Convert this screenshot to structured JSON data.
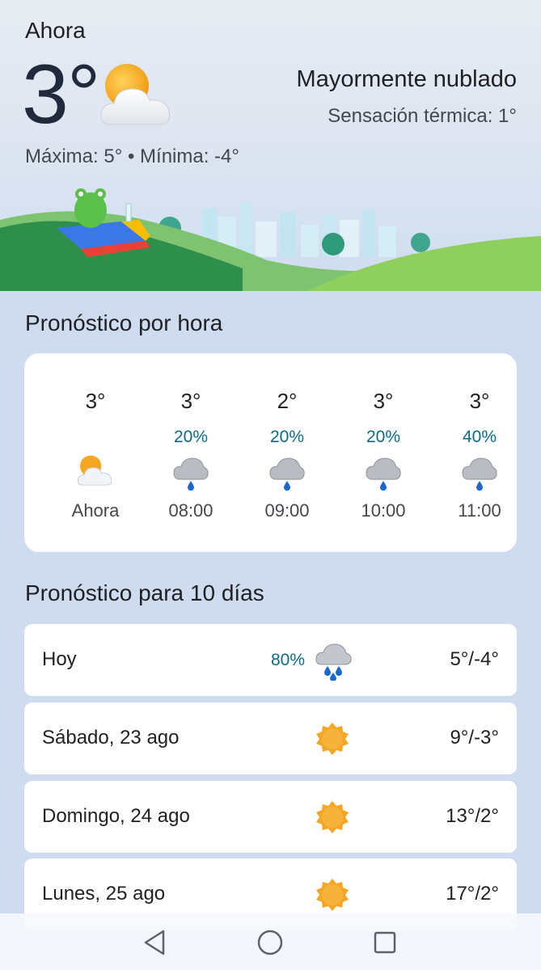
{
  "current": {
    "now_label": "Ahora",
    "temperature": "3°",
    "icon": "partly-cloudy-icon",
    "condition": "Mayormente nublado",
    "feels_like": "Sensación térmica: 1°",
    "high_low": "Máxima: 5° • Mínima: -4°"
  },
  "hourly": {
    "title": "Pronóstico por hora",
    "items": [
      {
        "temp": "3°",
        "pop": "",
        "icon": "partly-cloudy-icon",
        "time": "Ahora"
      },
      {
        "temp": "3°",
        "pop": "20%",
        "icon": "rain-cloud-icon",
        "time": "08:00"
      },
      {
        "temp": "2°",
        "pop": "20%",
        "icon": "rain-cloud-icon",
        "time": "09:00"
      },
      {
        "temp": "3°",
        "pop": "20%",
        "icon": "rain-cloud-icon",
        "time": "10:00"
      },
      {
        "temp": "3°",
        "pop": "40%",
        "icon": "rain-cloud-icon",
        "time": "11:00"
      }
    ]
  },
  "daily": {
    "title": "Pronóstico para 10 días",
    "items": [
      {
        "day": "Hoy",
        "pop": "80%",
        "icon": "heavy-rain-icon",
        "temps": "5°/-4°"
      },
      {
        "day": "Sábado, 23 ago",
        "pop": "",
        "icon": "sun-icon",
        "temps": "9°/-3°"
      },
      {
        "day": "Domingo, 24 ago",
        "pop": "",
        "icon": "sun-icon",
        "temps": "13°/2°"
      },
      {
        "day": "Lunes, 25 ago",
        "pop": "",
        "icon": "sun-icon",
        "temps": "17°/2°"
      }
    ]
  },
  "navbar": {
    "back": "back-triangle-icon",
    "home": "home-circle-icon",
    "recents": "recents-square-icon"
  },
  "colors": {
    "background": "#cfdcef",
    "card": "#ffffff",
    "precip_text": "#0b6b8a",
    "sun": "#f5a623"
  }
}
